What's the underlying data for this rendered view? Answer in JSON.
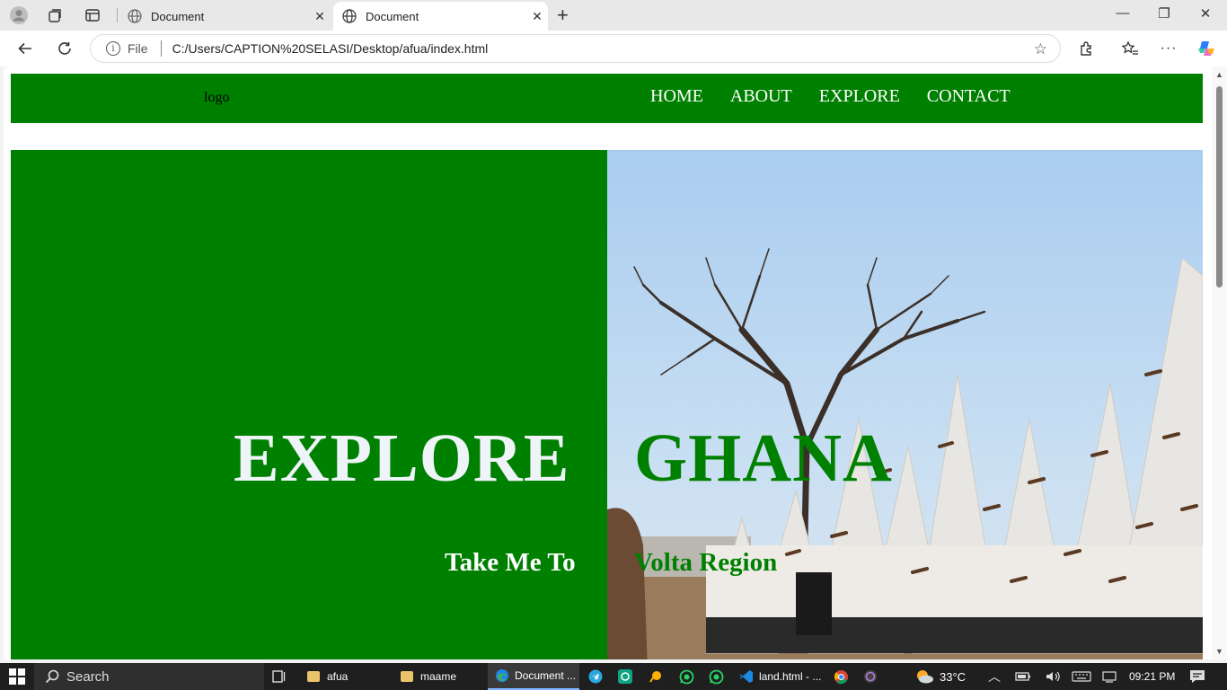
{
  "browser": {
    "tabs": [
      {
        "title": "Document",
        "active": false
      },
      {
        "title": "Document",
        "active": true
      }
    ],
    "address": {
      "file_label": "File",
      "url": "C:/Users/CAPTION%20SELASI/Desktop/afua/index.html"
    }
  },
  "page": {
    "nav": {
      "logo": "logo",
      "links": [
        "HOME",
        "ABOUT",
        "EXPLORE",
        "CONTACT"
      ]
    },
    "hero": {
      "headline_1": "EXPLORE",
      "headline_2": "GHANA",
      "sub_1": "Take Me To",
      "sub_2": "Volta Region"
    },
    "colors": {
      "brand_green": "#008000"
    }
  },
  "taskbar": {
    "search_label": "Search",
    "apps": [
      {
        "label": "afua",
        "icon": "folder-icon"
      },
      {
        "label": "maame",
        "icon": "folder-icon"
      },
      {
        "label": "Document ...",
        "icon": "edge-icon"
      },
      {
        "label": "land.html - ...",
        "icon": "vscode-icon"
      }
    ],
    "weather": "33°C",
    "time": "09:21 PM"
  }
}
